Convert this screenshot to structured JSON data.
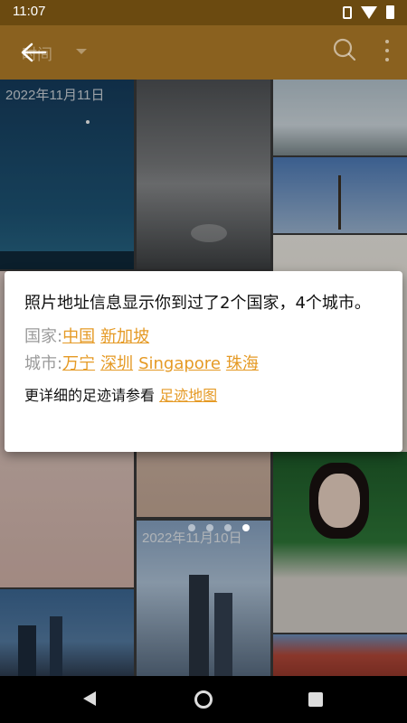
{
  "status": {
    "time": "11:07"
  },
  "toolbar": {
    "title": "时间"
  },
  "gallery": {
    "dates": [
      "2022年11月11日",
      "2022年11月10日"
    ]
  },
  "dialog": {
    "message": "照片地址信息显示你到过了2个国家，4个城市。",
    "countries_label": "国家:",
    "countries": [
      "中国",
      "新加坡"
    ],
    "cities_label": "城市:",
    "cities": [
      "万宁",
      "深圳",
      "Singapore",
      "珠海"
    ],
    "footer_text": "更详细的足迹请参看",
    "footer_link": "足迹地图"
  },
  "pager": {
    "count": 4,
    "active_index": 3
  }
}
